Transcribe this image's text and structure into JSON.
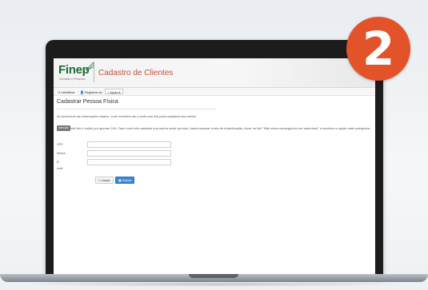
{
  "badge": {
    "number": "2",
    "color": "#e2532a"
  },
  "app": {
    "logo_text": "Finep",
    "logo_subtext": "Inovação e Pesquisa",
    "title": "Cadastro de Clientes"
  },
  "toolbar": {
    "items": [
      {
        "label": "Identificar",
        "icon": "login-icon"
      },
      {
        "label": "Registrar-se",
        "icon": "user-add-icon"
      },
      {
        "label": "Ajuda",
        "icon": "help-icon"
      }
    ]
  },
  "page": {
    "title": "Cadastrar Pessoa Física",
    "intro": "Ao preencher as informações abaixo, você receberá um e-mail com link para cadastrar sua senha.",
    "notice_badge": "Atenção",
    "notice_text": "Este link é válido por apenas 24h. Caso você não cadastre sua senha neste período, basta acessar a tela de Autenticação, clicar no link \"Não estou conseguindo me autenticar\" e escolher a opção mais adequada."
  },
  "form": {
    "fields": [
      {
        "label": "CPF",
        "value": ""
      },
      {
        "label": "Nome",
        "value": ""
      },
      {
        "label": "E-mail",
        "value": ""
      }
    ],
    "clear_label": "Limpar",
    "save_label": "Salvar"
  }
}
